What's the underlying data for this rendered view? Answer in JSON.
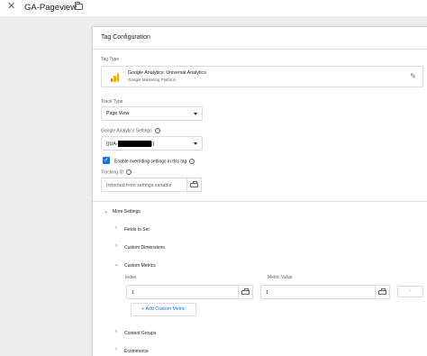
{
  "header": {
    "title": "GA-Pageview",
    "close_icon": "close-icon",
    "folder_icon": "folder-icon"
  },
  "card": {
    "title": "Tag Configuration",
    "tag_type_label": "Tag Type",
    "tag_type_name": "Google Analytics: Universal Analytics",
    "tag_type_vendor": "Google Marketing Platform",
    "track_type_label": "Track Type",
    "track_type_value": "Page View",
    "ga_settings_label": "Google Analytics Settings",
    "ga_settings_prefix": "{{UA-",
    "ga_settings_suffix": "}}",
    "override_label": "Enable overriding settings in this tag",
    "override_checked": true,
    "tracking_id_label": "Tracking ID",
    "tracking_id_placeholder": "Inherited from settings variable",
    "more_settings": "More Settings",
    "fields_to_set": "Fields to Set",
    "custom_dimensions": "Custom Dimensions",
    "custom_metrics": "Custom Metrics",
    "index_label": "Index",
    "metric_value_label": "Metric Value",
    "index_value": "1",
    "metric_value": "1",
    "add_metric": "+ Add Custom Metric",
    "content_groups": "Content Groups",
    "ecommerce": "Ecommerce",
    "remove_button": "-"
  },
  "colors": {
    "accent": "#1a73e8",
    "ga_icon": "#f9ab00"
  }
}
